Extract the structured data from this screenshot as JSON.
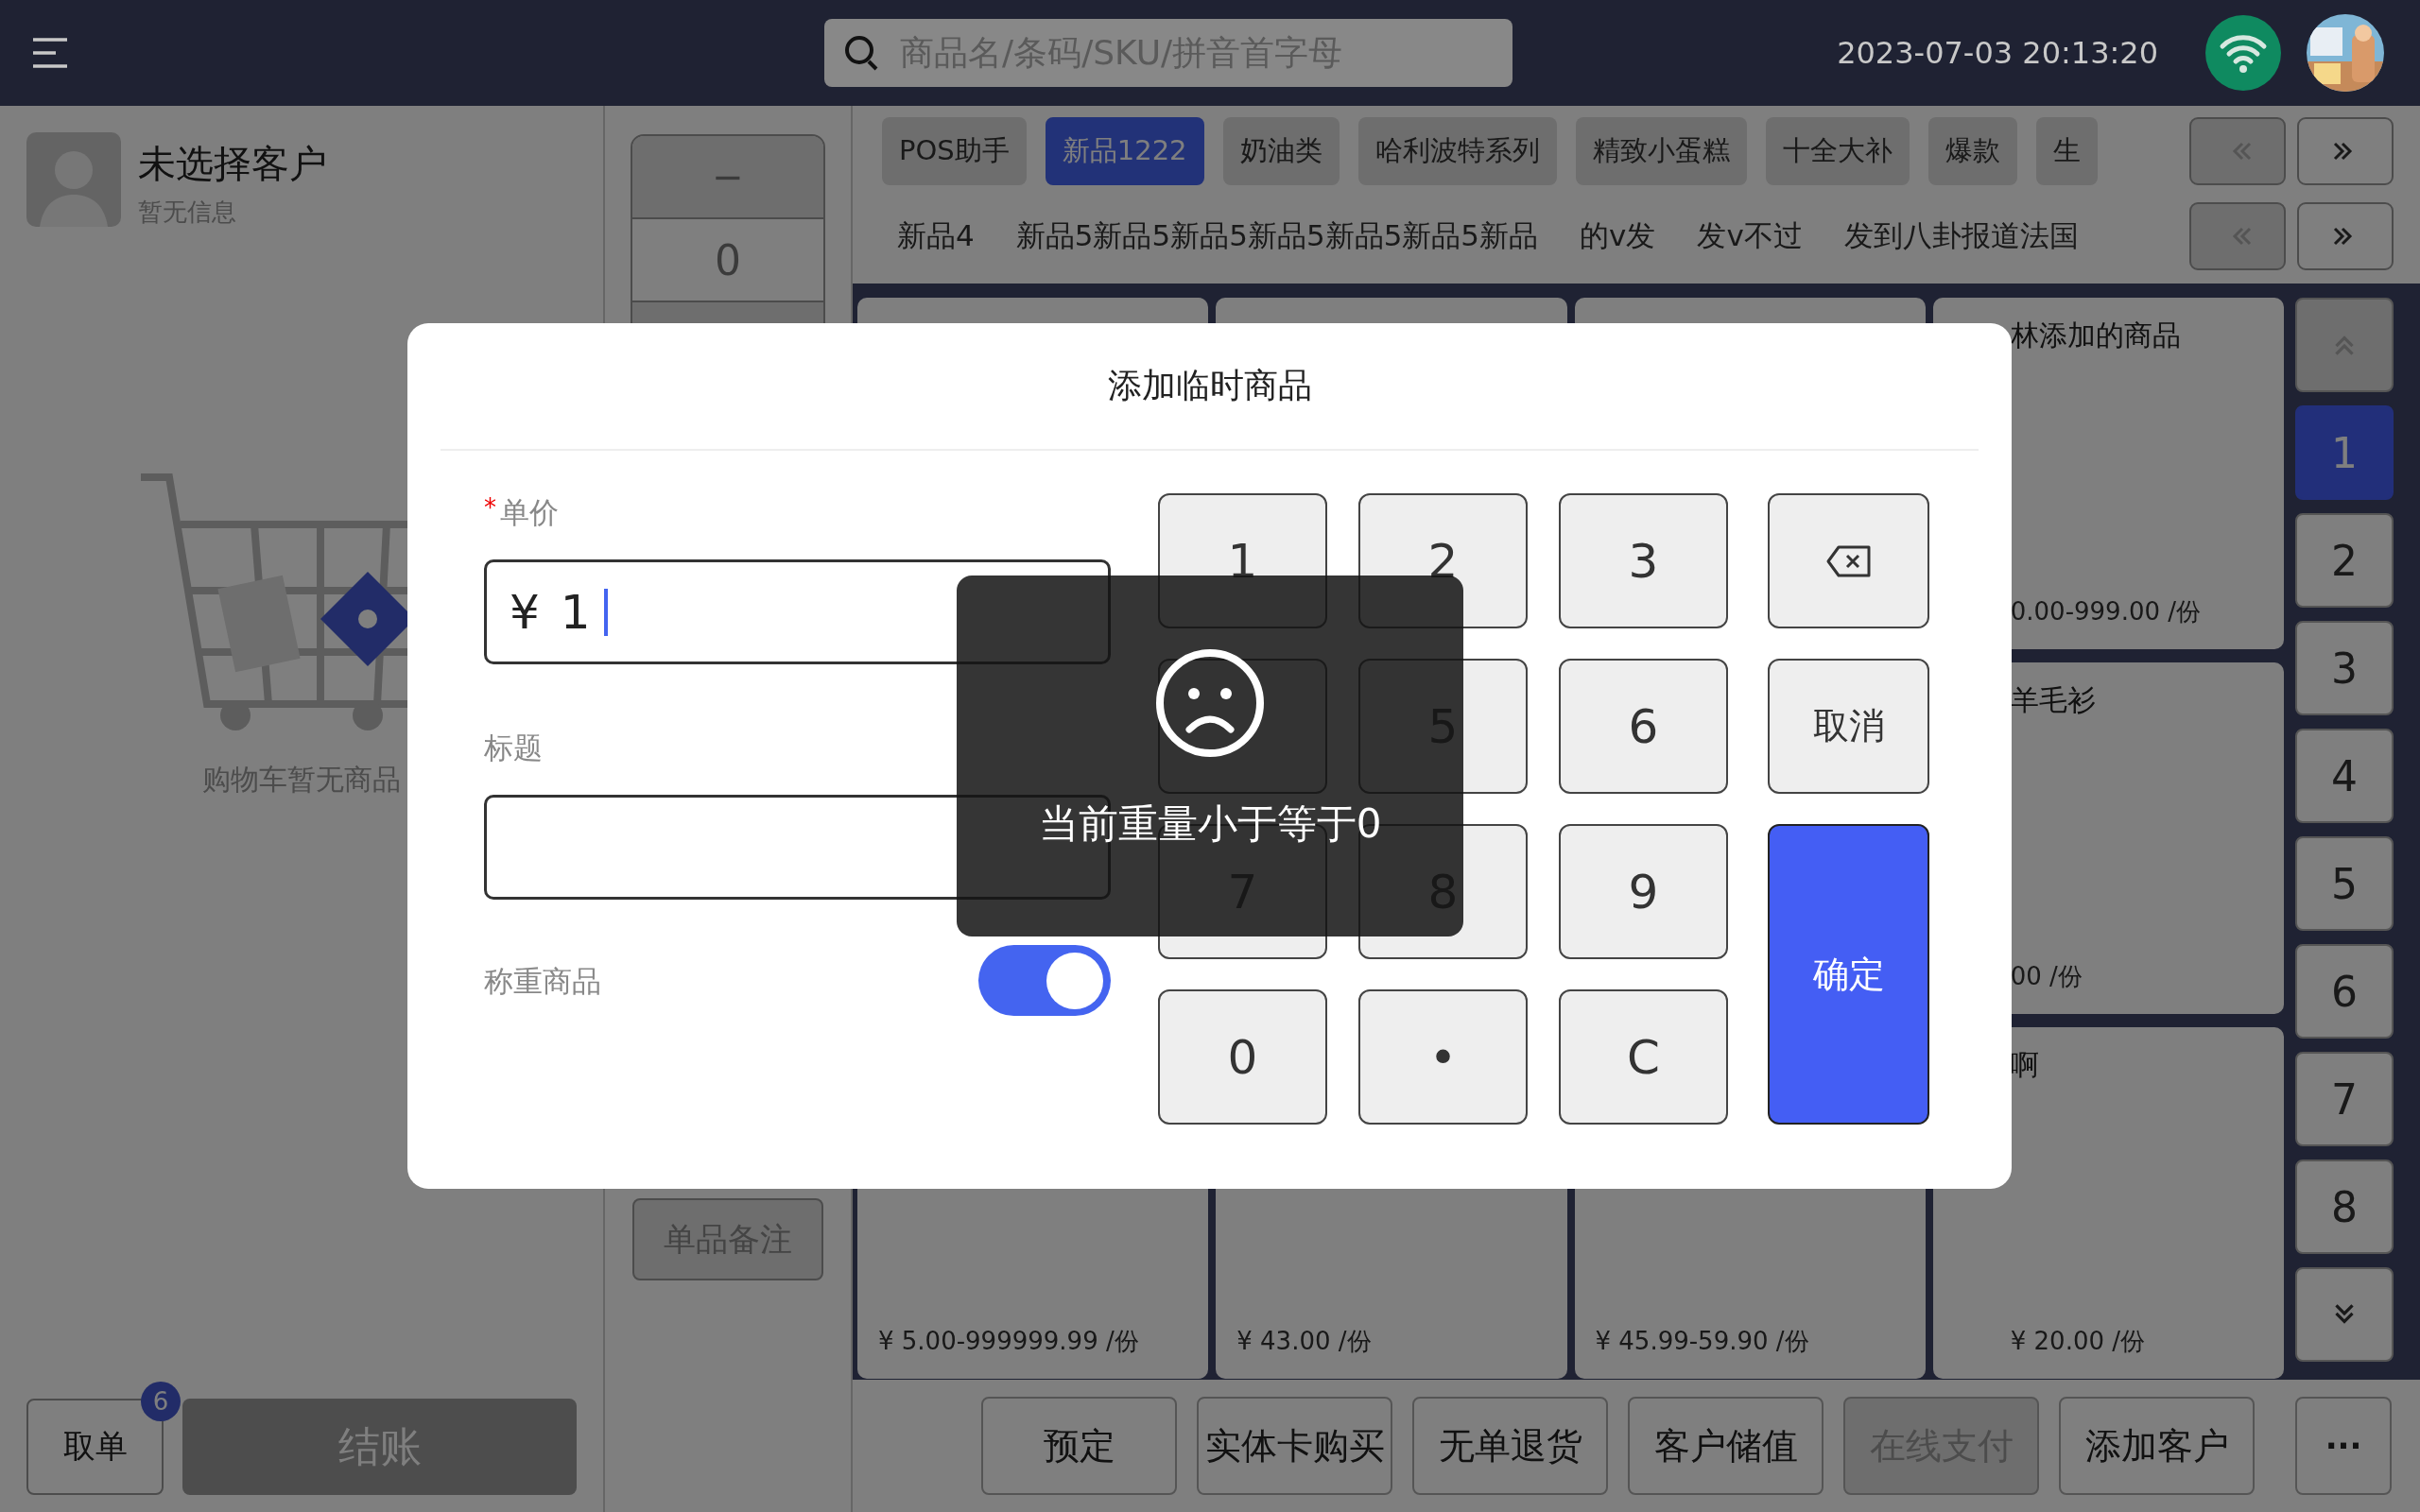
{
  "top_bar": {
    "search": {
      "placeholder": "商品名/条码/SKU/拼音首字母"
    },
    "datetime": "2023-07-03 20:13:20"
  },
  "customer": {
    "name": "未选择客户",
    "info": "暂无信息"
  },
  "cart": {
    "empty_text": "购物车暂无商品"
  },
  "pickup_button": {
    "label": "取单",
    "badge": "6"
  },
  "checkout_button": {
    "label": "结账",
    "disabled": true
  },
  "quantity": {
    "minus": "−",
    "value": "0"
  },
  "item_note_button": {
    "label": "单品备注",
    "disabled": true
  },
  "categories": [
    {
      "label": "POS助手",
      "selected": false
    },
    {
      "label": "新品1222",
      "selected": true
    },
    {
      "label": "奶油类",
      "selected": false
    },
    {
      "label": "哈利波特系列",
      "selected": false
    },
    {
      "label": "精致小蛋糕",
      "selected": false
    },
    {
      "label": "十全大补",
      "selected": false
    },
    {
      "label": "爆款",
      "selected": false
    },
    {
      "label": "生",
      "selected": false
    }
  ],
  "category_pager": {
    "prev_disabled": true,
    "next_disabled": false
  },
  "subcategories": [
    {
      "label": "新品4",
      "selected": false
    },
    {
      "label": "新品5新品5新品5新品5新品5新品5新品",
      "selected": false
    },
    {
      "label": "的v发",
      "selected": false
    },
    {
      "label": "发v不过",
      "selected": false
    },
    {
      "label": "发到八卦报道法国",
      "selected": false
    }
  ],
  "subcategory_pager": {
    "prev_disabled": true,
    "next_disabled": false
  },
  "products": [
    {
      "name": "林添加的商品",
      "price": "0.00-999.00 /份"
    },
    {
      "name": "羊毛衫",
      "price": "00 /份"
    },
    {
      "price": "¥ 5.00-999999.99 /份"
    },
    {
      "price": "¥ 43.00 /份"
    },
    {
      "price": "¥ 45.99-59.90 /份"
    },
    {
      "name": "啊",
      "price": "¥ 20.00 /份"
    }
  ],
  "product_pages": {
    "up_disabled": true,
    "pages": [
      {
        "label": "1",
        "selected": true
      },
      {
        "label": "2",
        "selected": false
      },
      {
        "label": "3",
        "selected": false
      },
      {
        "label": "4",
        "selected": false
      },
      {
        "label": "5",
        "selected": false
      },
      {
        "label": "6",
        "selected": false
      },
      {
        "label": "7",
        "selected": false
      },
      {
        "label": "8",
        "selected": false
      }
    ]
  },
  "actions": [
    {
      "label": "预定",
      "disabled": false
    },
    {
      "label": "实体卡购买",
      "disabled": false
    },
    {
      "label": "无单退货",
      "disabled": false
    },
    {
      "label": "客户储值",
      "disabled": false
    },
    {
      "label": "在线支付",
      "disabled": true
    },
    {
      "label": "添加客户",
      "disabled": false
    }
  ],
  "more_button": "···",
  "dialog": {
    "title": "添加临时商品",
    "required_mark": "*",
    "price_label": "单价",
    "currency": "¥",
    "price_value": "1",
    "title_label": "标题",
    "weighed_label": "称重商品",
    "weighed_on": true,
    "keys": [
      {
        "kind": "digit",
        "label": "1"
      },
      {
        "kind": "digit",
        "label": "2"
      },
      {
        "kind": "digit",
        "label": "3"
      },
      {
        "kind": "backspace"
      },
      {
        "kind": "digit"
      },
      {
        "kind": "digit",
        "label": "5"
      },
      {
        "kind": "digit",
        "label": "6"
      },
      {
        "kind": "cancel",
        "label": "取消"
      },
      {
        "kind": "digit",
        "label": "7"
      },
      {
        "kind": "digit",
        "label": "8"
      },
      {
        "kind": "digit",
        "label": "9"
      },
      {
        "kind": "confirm",
        "label": "确定"
      },
      {
        "kind": "digit",
        "label": "0"
      },
      {
        "kind": "digit",
        "label": "•"
      },
      {
        "kind": "digit",
        "label": "C"
      }
    ]
  },
  "toast": {
    "message": "当前重量小于等于0"
  }
}
